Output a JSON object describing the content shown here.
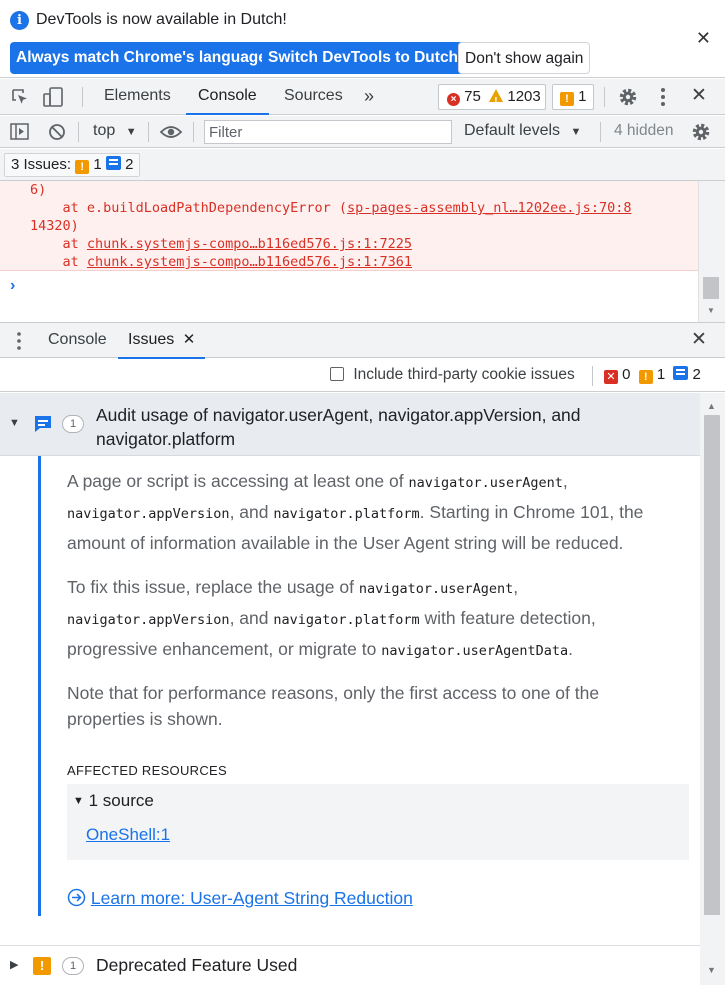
{
  "infobar": {
    "message": "DevTools is now available in Dutch!",
    "buttons": {
      "match": "Always match Chrome's language",
      "switch": "Switch DevTools to Dutch",
      "dismiss": "Don't show again"
    }
  },
  "main_tabs": {
    "elements": "Elements",
    "console": "Console",
    "sources": "Sources",
    "more": "»"
  },
  "counters": {
    "errors": "75",
    "warnings": "1203",
    "issues": "1"
  },
  "console_toolbar": {
    "context": "top",
    "filter_placeholder": "Filter",
    "levels": "Default levels",
    "hidden": "4 hidden"
  },
  "issues_bar": {
    "label": "3 Issues:",
    "warn_count": "1",
    "info_count": "2"
  },
  "console_lines": {
    "line0": "6)",
    "line1_prefix": "    at e.buildLoadPathDependencyError (",
    "line1_link": "sp-pages-assembly_nl…1202ee.js:70:8",
    "line2": "14320)",
    "line3_prefix": "    at ",
    "line3_link": "chunk.systemjs-compo…b116ed576.js:1:7225",
    "line4_prefix": "    at ",
    "line4_link": "chunk.systemjs-compo…b116ed576.js:1:7361",
    "prompt": "›"
  },
  "drawer": {
    "tab_console": "Console",
    "tab_issues": "Issues",
    "third_party_label": "Include third-party cookie issues",
    "err_count": "0",
    "warn_count": "1",
    "info_count": "2"
  },
  "issue1": {
    "count": "1",
    "title_line1": "Audit usage of navigator.userAgent, navigator.appVersion, and",
    "title_line2": "navigator.platform",
    "p1": {
      "t1": "A page or script is accessing at least one of ",
      "c1": "navigator.userAgent",
      "t2": ",",
      "c2": "navigator.appVersion",
      "t3": ", and ",
      "c3": "navigator.platform",
      "t4": ". Starting in Chrome 101, the",
      "t5": "amount of information available in the User Agent string will be reduced."
    },
    "p2": {
      "t1": "To fix this issue, replace the usage of ",
      "c1": "navigator.userAgent",
      "t2": ",",
      "c2": "navigator.appVersion",
      "t3": ", and ",
      "c3": "navigator.platform",
      "t4": " with feature detection,",
      "t5": "progressive enhancement, or migrate to ",
      "c4": "navigator.userAgentData",
      "t6": "."
    },
    "p3": {
      "l1": "Note that for performance reasons, only the first access to one of the",
      "l2": "properties is shown."
    },
    "affected_label": "AFFECTED RESOURCES",
    "source_toggle": "1 source",
    "source_link": "OneShell:1",
    "learn_more": "Learn more: User-Agent String Reduction"
  },
  "issue2": {
    "count": "1",
    "title": "Deprecated Feature Used"
  }
}
